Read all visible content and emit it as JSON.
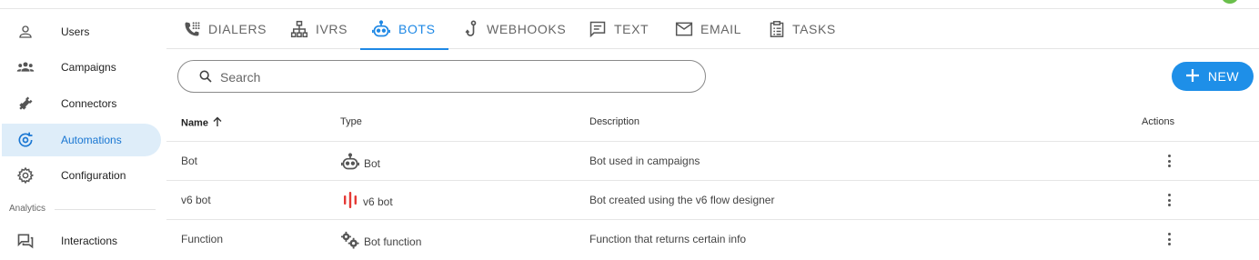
{
  "sidebar": {
    "items": [
      {
        "label": "Users",
        "icon": "person-icon"
      },
      {
        "label": "Campaigns",
        "icon": "group-icon"
      },
      {
        "label": "Connectors",
        "icon": "plug-icon"
      },
      {
        "label": "Automations",
        "icon": "automation-icon",
        "active": true
      },
      {
        "label": "Configuration",
        "icon": "gear-icon"
      }
    ],
    "section_label": "Analytics",
    "analytics_items": [
      {
        "label": "Interactions",
        "icon": "chat-icon"
      }
    ]
  },
  "tabs": [
    {
      "label": "DIALERS",
      "icon": "phone-dialpad-icon"
    },
    {
      "label": "IVRS",
      "icon": "sitemap-icon"
    },
    {
      "label": "BOTS",
      "icon": "robot-icon",
      "active": true
    },
    {
      "label": "WEBHOOKS",
      "icon": "hook-icon"
    },
    {
      "label": "TEXT",
      "icon": "message-icon"
    },
    {
      "label": "EMAIL",
      "icon": "mail-icon"
    },
    {
      "label": "TASKS",
      "icon": "clipboard-icon"
    }
  ],
  "search": {
    "placeholder": "Search",
    "value": ""
  },
  "new_button": {
    "label": "NEW"
  },
  "table": {
    "columns": {
      "name": "Name",
      "type": "Type",
      "description": "Description",
      "actions": "Actions"
    },
    "sort": {
      "column": "Name",
      "direction": "ascending"
    },
    "rows": [
      {
        "name": "Bot",
        "type": "Bot",
        "type_icon": "robot-icon",
        "description": "Bot used in campaigns"
      },
      {
        "name": "v6 bot",
        "type": "v6 bot",
        "type_icon": "v6-bars-icon",
        "description": "Bot created using the v6 flow designer"
      },
      {
        "name": "Function",
        "type": "Bot function",
        "type_icon": "cogs-icon",
        "description": "Function that returns certain info"
      }
    ]
  },
  "colors": {
    "accent": "#1e88e5",
    "active_nav_bg": "#deedf9",
    "v6_icon": "#e53935",
    "avatar": "#6abf4b"
  }
}
